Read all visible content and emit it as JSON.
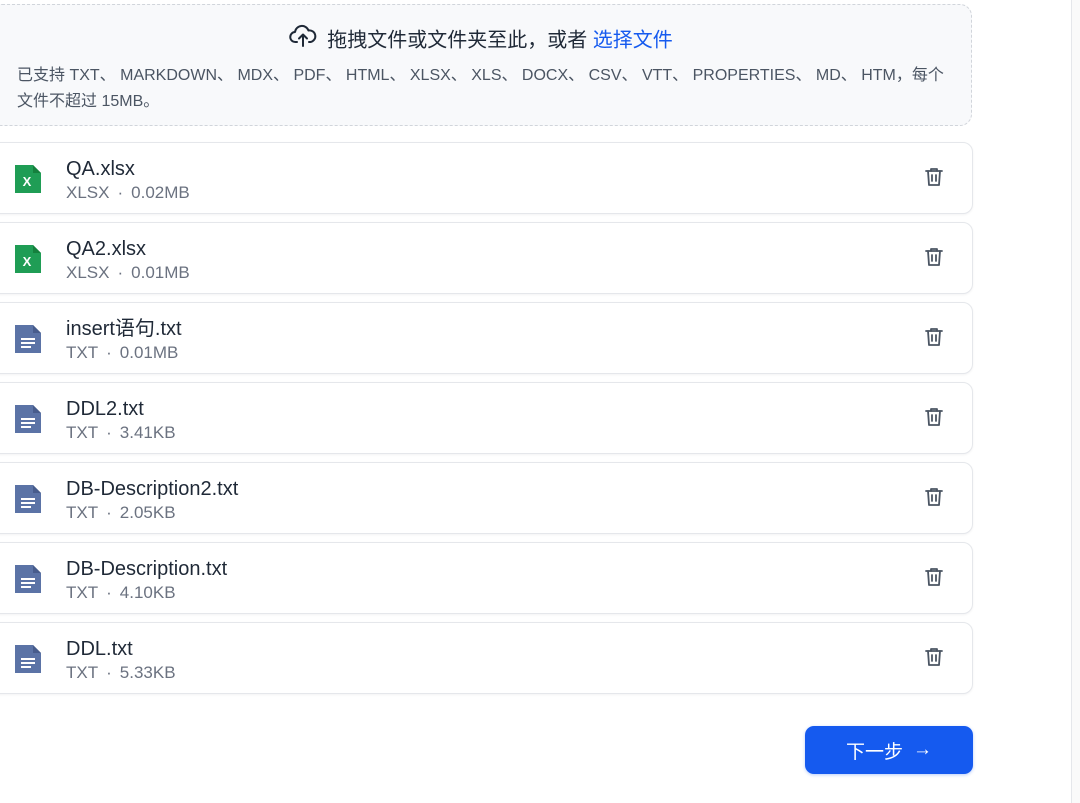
{
  "dropzone": {
    "title_prefix": "拖拽文件或文件夹至此，或者 ",
    "title_link": "选择文件",
    "hint": "已支持 TXT、 MARKDOWN、 MDX、 PDF、 HTML、 XLSX、 XLS、 DOCX、 CSV、 VTT、 PROPERTIES、 MD、 HTM，每个文件不超过 15MB。",
    "icon": "cloud-upload-icon"
  },
  "files": [
    {
      "name": "QA.xlsx",
      "type": "XLSX",
      "size": "0.02MB",
      "icon": "excel-file-icon"
    },
    {
      "name": "QA2.xlsx",
      "type": "XLSX",
      "size": "0.01MB",
      "icon": "excel-file-icon"
    },
    {
      "name": "insert语句.txt",
      "type": "TXT",
      "size": "0.01MB",
      "icon": "text-file-icon"
    },
    {
      "name": "DDL2.txt",
      "type": "TXT",
      "size": "3.41KB",
      "icon": "text-file-icon"
    },
    {
      "name": "DB-Description2.txt",
      "type": "TXT",
      "size": "2.05KB",
      "icon": "text-file-icon"
    },
    {
      "name": "DB-Description.txt",
      "type": "TXT",
      "size": "4.10KB",
      "icon": "text-file-icon"
    },
    {
      "name": "DDL.txt",
      "type": "TXT",
      "size": "5.33KB",
      "icon": "text-file-icon"
    }
  ],
  "meta_separator": "·",
  "next_button": {
    "label": "下一步",
    "arrow": "→"
  },
  "colors": {
    "accent": "#155aef",
    "excel_green": "#1f9d55",
    "txt_blue": "#5b73a6",
    "muted": "#6b7280"
  }
}
